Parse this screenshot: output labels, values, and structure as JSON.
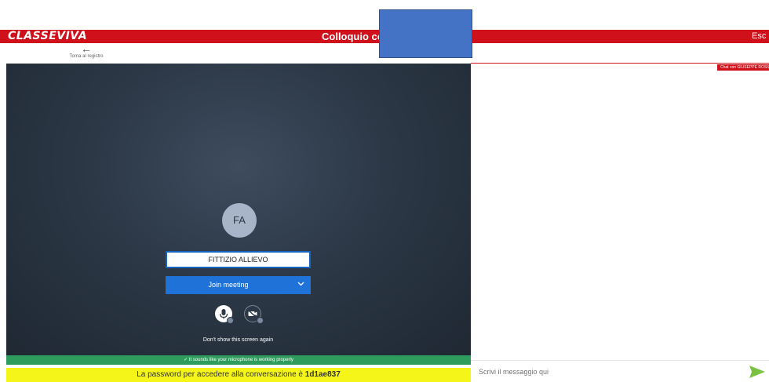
{
  "header": {
    "logo": "CLASSEVIVA",
    "title": "Colloquio con",
    "exit_label": "Esc"
  },
  "nav": {
    "back_label": "Torna al registro"
  },
  "meeting": {
    "avatar_initials": "FA",
    "name_value": "FITTIZIO ALLIEVO",
    "join_label": "Join meeting",
    "dont_show_label": "Don't show this screen again",
    "mic_status": "✓  It sounds like your microphone is working properly",
    "icons": [
      "microphone-icon",
      "camera-off-icon",
      "chevron-down-icon"
    ]
  },
  "password_bar": {
    "text": "La password per accedere alla conversazione è",
    "code": "1d1ae837"
  },
  "chat": {
    "tab_label": "Chat con GIUSEPPE ROSSITTO",
    "input_placeholder": "Scrivi il messaggio qui"
  },
  "colors": {
    "brand": "#d0111b",
    "join": "#1f73d8",
    "mic_ok": "#2e9c5c",
    "password_bg": "#f5f51a",
    "send": "#7cc242"
  }
}
